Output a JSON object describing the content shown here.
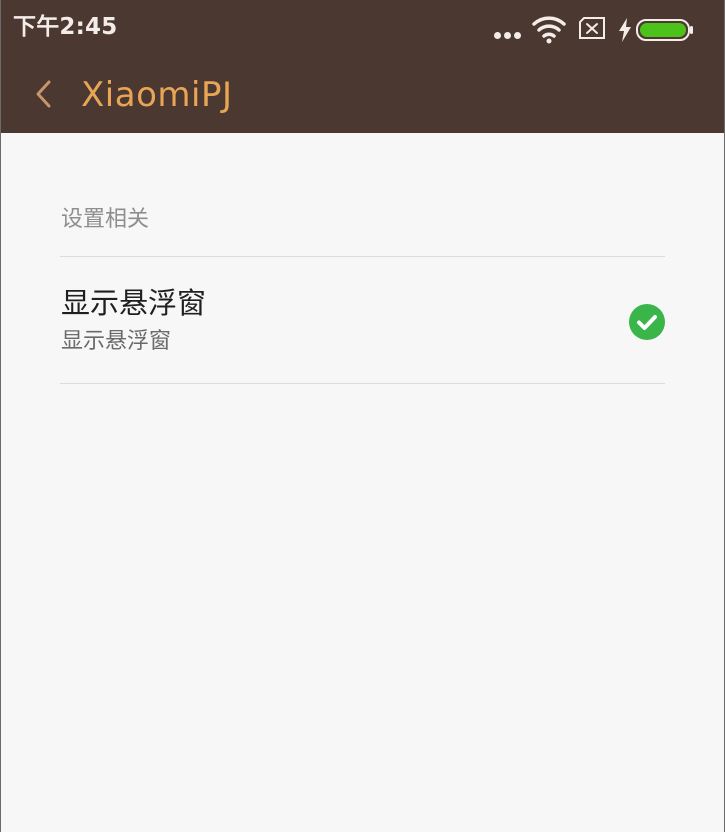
{
  "status_bar": {
    "time": "下午2:45",
    "icons": [
      "more-dots-icon",
      "wifi-icon",
      "no-sim-icon",
      "charging-icon",
      "battery-icon"
    ],
    "battery_color": "#4cc31a"
  },
  "app_bar": {
    "title": "XiaomiPJ",
    "back_icon": "chevron-left-icon",
    "background": "#4b3830",
    "title_color": "#e9a556"
  },
  "preferences": {
    "section_title": "设置相关",
    "items": [
      {
        "title": "显示悬浮窗",
        "summary": "显示悬浮窗",
        "checked": true,
        "check_color": "#39b54a"
      }
    ]
  }
}
